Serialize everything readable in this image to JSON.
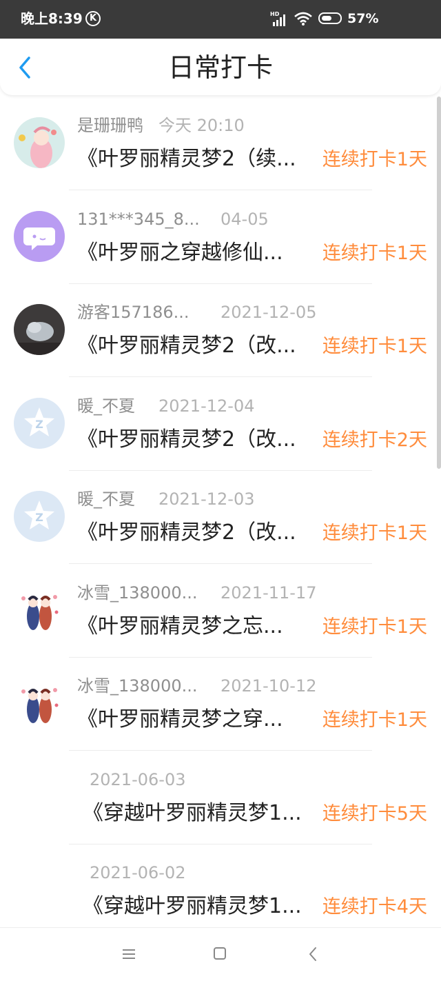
{
  "status_bar": {
    "time": "晚上8:39",
    "k_badge": "K",
    "battery": "57%",
    "battery_level": 0.57
  },
  "header": {
    "title": "日常打卡"
  },
  "items": [
    {
      "username": "是珊珊鸭",
      "date": "今天 20:10",
      "book": "《叶罗丽精灵梦2（续...",
      "streak": "连续打卡1天",
      "avatar": "anime-girl-avatar"
    },
    {
      "username": "131***345_8...",
      "date": "04-05",
      "book": "《叶罗丽之穿越修仙...",
      "streak": "连续打卡1天",
      "avatar": "chat-bubble-avatar"
    },
    {
      "username": "游客157186...",
      "date": "2021-12-05",
      "book": "《叶罗丽精灵梦2（改...",
      "streak": "连续打卡1天",
      "avatar": "photo-avatar"
    },
    {
      "username": "暖_不夏",
      "date": "2021-12-04",
      "book": "《叶罗丽精灵梦2（改...",
      "streak": "连续打卡2天",
      "avatar": "default-star-avatar"
    },
    {
      "username": "暖_不夏",
      "date": "2021-12-03",
      "book": "《叶罗丽精灵梦2（改...",
      "streak": "连续打卡1天",
      "avatar": "default-star-avatar"
    },
    {
      "username": "冰雪_138000...",
      "date": "2021-11-17",
      "book": "《叶罗丽精灵梦之忘...",
      "streak": "连续打卡1天",
      "avatar": "anime-couple-avatar"
    },
    {
      "username": "冰雪_138000...",
      "date": "2021-10-12",
      "book": "《叶罗丽精灵梦之穿...",
      "streak": "连续打卡1天",
      "avatar": "anime-couple-avatar"
    },
    {
      "username": "",
      "date": "2021-06-03",
      "book": "《穿越叶罗丽精灵梦1...",
      "streak": "连续打卡5天",
      "avatar": ""
    },
    {
      "username": "",
      "date": "2021-06-02",
      "book": "《穿越叶罗丽精灵梦1...",
      "streak": "连续打卡4天",
      "avatar": ""
    }
  ],
  "colors": {
    "accent": "#ff8c3c",
    "back_arrow": "#1e9bf0",
    "status_bar_bg": "#3a3a3a"
  }
}
